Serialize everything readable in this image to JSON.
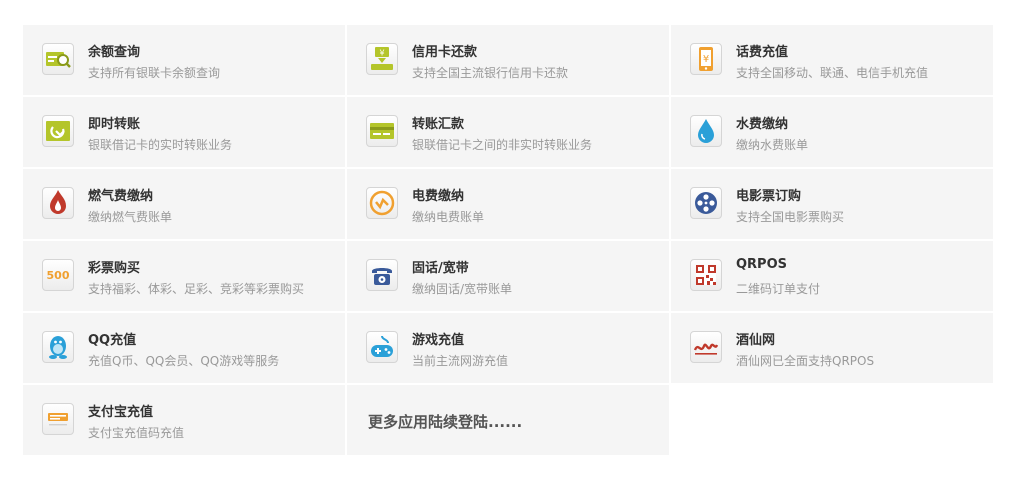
{
  "services": [
    {
      "title": "余额查询",
      "desc": "支持所有银联卡余额查询",
      "icon": "balance-search-icon"
    },
    {
      "title": "信用卡还款",
      "desc": "支持全国主流银行信用卡还款",
      "icon": "credit-card-repay-icon"
    },
    {
      "title": "话费充值",
      "desc": "支持全国移动、联通、电信手机充值",
      "icon": "phone-recharge-icon"
    },
    {
      "title": "即时转账",
      "desc": "银联借记卡的实时转账业务",
      "icon": "instant-transfer-icon"
    },
    {
      "title": "转账汇款",
      "desc": "银联借记卡之间的非实时转账业务",
      "icon": "remittance-icon"
    },
    {
      "title": "水费缴纳",
      "desc": "缴纳水费账单",
      "icon": "water-drop-icon"
    },
    {
      "title": "燃气费缴纳",
      "desc": "缴纳燃气费账单",
      "icon": "gas-flame-icon"
    },
    {
      "title": "电费缴纳",
      "desc": "缴纳电费账单",
      "icon": "electricity-icon"
    },
    {
      "title": "电影票订购",
      "desc": "支持全国电影票购买",
      "icon": "film-reel-icon"
    },
    {
      "title": "彩票购买",
      "desc": "支持福彩、体彩、足彩、竞彩等彩票购买",
      "icon": "lottery-500-icon",
      "icon_text": "500"
    },
    {
      "title": "固话/宽带",
      "desc": "缴纳固话/宽带账单",
      "icon": "telephone-icon"
    },
    {
      "title": "QRPOS",
      "desc": "二维码订单支付",
      "icon": "qr-code-icon"
    },
    {
      "title": "QQ充值",
      "desc": "充值Q币、QQ会员、QQ游戏等服务",
      "icon": "qq-penguin-icon"
    },
    {
      "title": "游戏充值",
      "desc": "当前主流网游充值",
      "icon": "gamepad-icon"
    },
    {
      "title": "酒仙网",
      "desc": "酒仙网已全面支持QRPOS",
      "icon": "jiuxian-logo-icon"
    },
    {
      "title": "支付宝充值",
      "desc": "支付宝充值码充值",
      "icon": "alipay-logo-icon"
    }
  ],
  "more_text": "更多应用陆续登陆......",
  "colors": {
    "tile_bg": "#f5f5f5",
    "title": "#333333",
    "desc": "#999999",
    "green": "#b4c52a",
    "orange": "#f0a030",
    "blue": "#2aa0d8",
    "red": "#c0392b",
    "navy": "#3a5a9a"
  }
}
